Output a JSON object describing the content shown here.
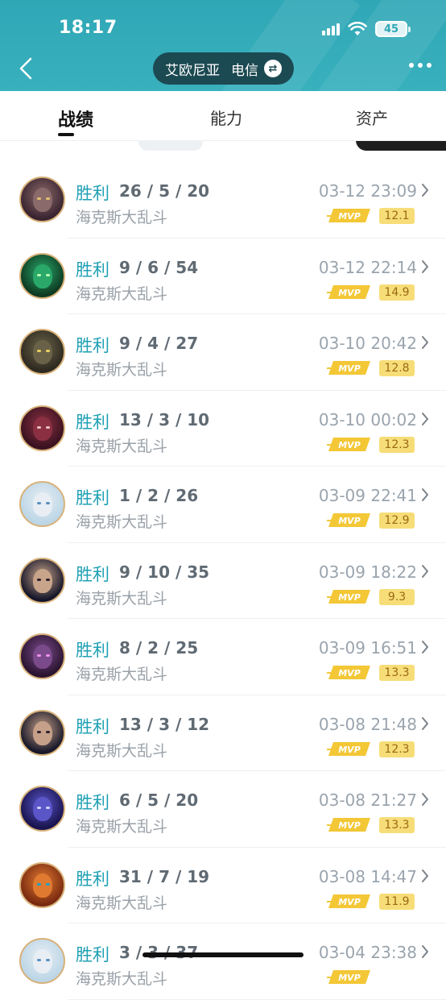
{
  "status_bar": {
    "time": "18:17",
    "battery": "45"
  },
  "header": {
    "server": "艾欧尼亚",
    "isp": "电信",
    "swap_icon": "swap-icon",
    "back_icon": "chevron-left-icon",
    "more_icon": "more-dots-icon"
  },
  "tabs": [
    {
      "label": "战绩",
      "active": true
    },
    {
      "label": "能力",
      "active": false
    },
    {
      "label": "资产",
      "active": false
    }
  ],
  "colors": {
    "header_bg": "#2fa7b6",
    "result_win": "#1fa0b3",
    "score_bg": "#f7dd78",
    "avatar_ring": "#d8b27a"
  },
  "matches": [
    {
      "result": "胜利",
      "kda": "26 / 5 / 20",
      "mode": "海克斯大乱斗",
      "date": "03-12 23:09",
      "badge": "MVP",
      "score": "12.1",
      "avatar_bg": "#3a2430",
      "face": "#8a6a6a",
      "eye": "#e0c070"
    },
    {
      "result": "胜利",
      "kda": "9 / 6 / 54",
      "mode": "海克斯大乱斗",
      "date": "03-12 22:14",
      "badge": "MVP",
      "score": "14.9",
      "avatar_bg": "#0e3a22",
      "face": "#29a86a",
      "eye": "#b8ffb0"
    },
    {
      "result": "胜利",
      "kda": "9 / 4 / 27",
      "mode": "海克斯大乱斗",
      "date": "03-10 20:42",
      "badge": "MVP",
      "score": "12.8",
      "avatar_bg": "#2e2a20",
      "face": "#6a6248",
      "eye": "#e8d060"
    },
    {
      "result": "胜利",
      "kda": "13 / 3 / 10",
      "mode": "海克斯大乱斗",
      "date": "03-10 00:02",
      "badge": "MVP",
      "score": "12.3",
      "avatar_bg": "#3a1220",
      "face": "#8a3042",
      "eye": "#f0c0c0"
    },
    {
      "result": "胜利",
      "kda": "1 / 2 / 26",
      "mode": "海克斯大乱斗",
      "date": "03-09 22:41",
      "badge": "MVP",
      "score": "12.9",
      "avatar_bg": "#bcd6e6",
      "face": "#e8eef4",
      "eye": "#5a90c0"
    },
    {
      "result": "胜利",
      "kda": "9 / 10 / 35",
      "mode": "海克斯大乱斗",
      "date": "03-09 18:22",
      "badge": "MVP",
      "score": "9.3",
      "avatar_bg": "#16162a",
      "face": "#c8a48a",
      "eye": "#302030"
    },
    {
      "result": "胜利",
      "kda": "8 / 2 / 25",
      "mode": "海克斯大乱斗",
      "date": "03-09 16:51",
      "badge": "MVP",
      "score": "13.3",
      "avatar_bg": "#2a1430",
      "face": "#7a4a8a",
      "eye": "#f090f0"
    },
    {
      "result": "胜利",
      "kda": "13 / 3 / 12",
      "mode": "海克斯大乱斗",
      "date": "03-08 21:48",
      "badge": "MVP",
      "score": "12.3",
      "avatar_bg": "#18182a",
      "face": "#c6a088",
      "eye": "#302030"
    },
    {
      "result": "胜利",
      "kda": "6 / 5 / 20",
      "mode": "海克斯大乱斗",
      "date": "03-08 21:27",
      "badge": "MVP",
      "score": "13.3",
      "avatar_bg": "#1a1450",
      "face": "#5a56c8",
      "eye": "#d0d0ff"
    },
    {
      "result": "胜利",
      "kda": "31 / 7 / 19",
      "mode": "海克斯大乱斗",
      "date": "03-08 14:47",
      "badge": "MVP",
      "score": "11.9",
      "avatar_bg": "#7a2a10",
      "face": "#e07a30",
      "eye": "#20a0c0"
    },
    {
      "result": "胜利",
      "kda": "3 / 3 / 37",
      "mode": "海克斯大乱斗",
      "date": "03-04 23:38",
      "badge": "MVP",
      "score": "",
      "avatar_bg": "#bcd6e6",
      "face": "#e8eef4",
      "eye": "#5a90c0"
    }
  ]
}
